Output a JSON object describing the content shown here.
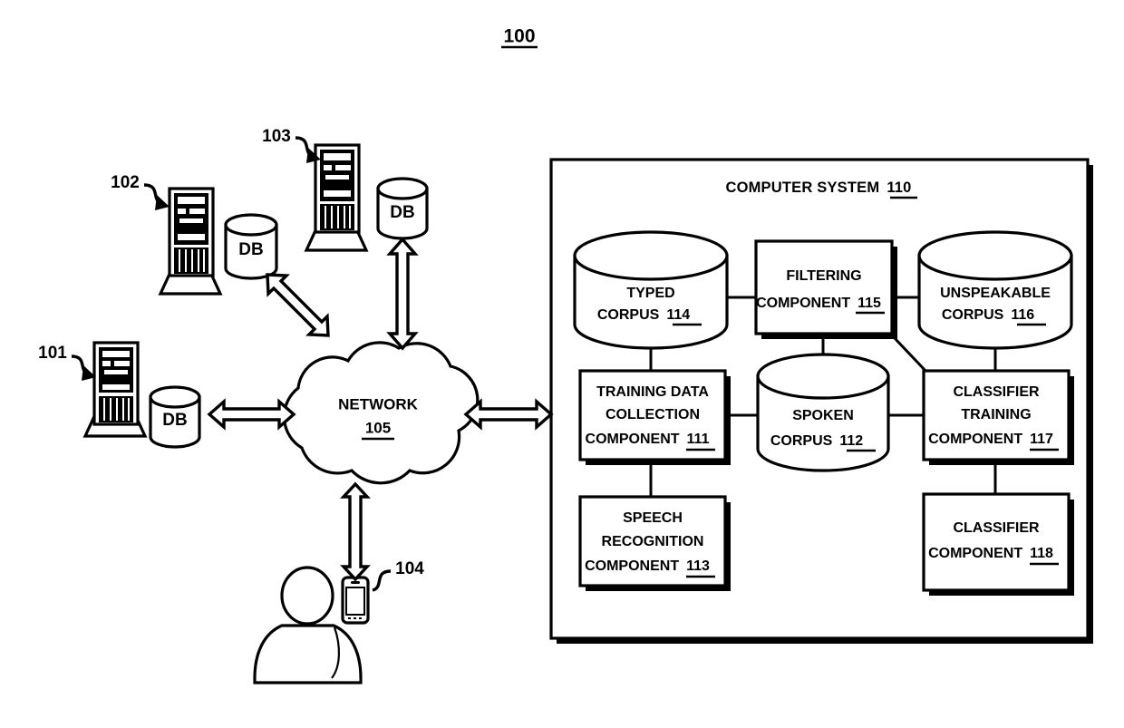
{
  "figure": {
    "number": "100",
    "type": "patent-block-diagram"
  },
  "computer_system": {
    "title_text": "COMPUTER SYSTEM",
    "title_ref": "110",
    "boxes": [
      {
        "id": "filtering",
        "line1": "FILTERING",
        "line2": "COMPONENT",
        "line3": "",
        "ref": "115"
      },
      {
        "id": "training-data",
        "line1": "TRAINING DATA",
        "line2": "COLLECTION",
        "line3": "COMPONENT",
        "ref": "111"
      },
      {
        "id": "classifier-train",
        "line1": "CLASSIFIER",
        "line2": "TRAINING",
        "line3": "COMPONENT",
        "ref": "117"
      },
      {
        "id": "speech-recog",
        "line1": "SPEECH",
        "line2": "RECOGNITION",
        "line3": "COMPONENT",
        "ref": "113"
      },
      {
        "id": "classifier",
        "line1": "CLASSIFIER",
        "line2": "COMPONENT",
        "line3": "",
        "ref": "118"
      }
    ],
    "cylinders": [
      {
        "id": "typed-corpus",
        "line1": "TYPED",
        "line2": "CORPUS",
        "ref": "114"
      },
      {
        "id": "unspeakable-corpus",
        "line1": "UNSPEAKABLE",
        "line2": "CORPUS",
        "ref": "116"
      },
      {
        "id": "spoken-corpus",
        "line1": "SPOKEN",
        "line2": "CORPUS",
        "ref": "112"
      }
    ]
  },
  "network": {
    "label": "NETWORK",
    "ref": "105"
  },
  "clients": [
    {
      "id": "client-101",
      "ref": "101",
      "db_label": "DB"
    },
    {
      "id": "client-102",
      "ref": "102",
      "db_label": "DB"
    },
    {
      "id": "client-103",
      "ref": "103",
      "db_label": "DB"
    }
  ],
  "mobile_user": {
    "ref": "104"
  },
  "colors": {
    "ink": "#000000",
    "paper": "#ffffff"
  }
}
